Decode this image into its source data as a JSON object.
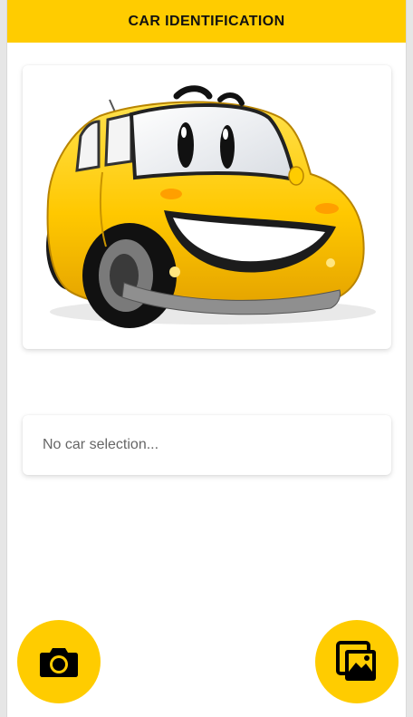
{
  "app_bar": {
    "title": "CAR IDENTIFICATION"
  },
  "preview": {
    "icon": "cartoon-yellow-car-illustration"
  },
  "result": {
    "text": "No car selection..."
  },
  "actions": {
    "camera_icon": "camera-icon",
    "gallery_icon": "gallery-icon"
  },
  "colors": {
    "accent": "#ffcc00",
    "background": "#ffffff",
    "result_text": "#666666"
  }
}
